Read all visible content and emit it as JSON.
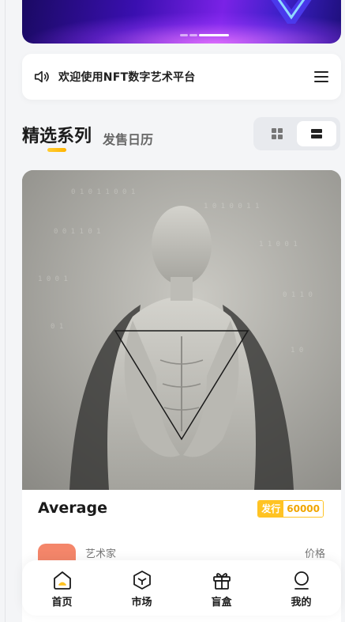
{
  "banner": {
    "slide_count": 3,
    "active_slide": 2
  },
  "notice": {
    "text": "欢迎使用NFT数字艺术平台",
    "icon": "speaker-icon",
    "menu_icon": "menu-icon"
  },
  "section": {
    "title": "精选系列",
    "subtitle": "发售日历",
    "view_modes": [
      "grid",
      "list"
    ],
    "active_view": "list"
  },
  "card": {
    "title": "Average",
    "badge_key": "发行",
    "badge_value": "60000",
    "artist_label": "艺术家",
    "price_label": "价格"
  },
  "tabs": [
    {
      "label": "首页",
      "icon": "home-icon",
      "active": true
    },
    {
      "label": "市场",
      "icon": "cube-icon",
      "active": false
    },
    {
      "label": "盲盒",
      "icon": "gift-icon",
      "active": false
    },
    {
      "label": "我的",
      "icon": "user-icon",
      "active": false
    }
  ],
  "colors": {
    "accent": "#ffc323",
    "banner_purple": "#7a22e6",
    "artist_avatar": "#f4866a"
  }
}
